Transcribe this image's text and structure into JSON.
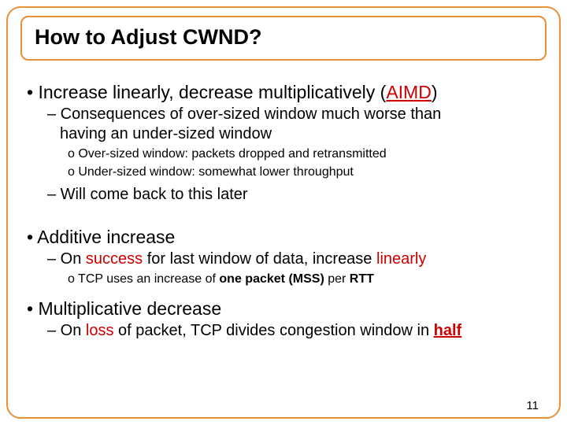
{
  "title": "How to Adjust CWND?",
  "b1": {
    "pre": "• Increase linearly, decrease multiplicatively (",
    "aimd": "AIMD",
    "post": ")"
  },
  "b1s1a": "– Consequences of over-sized window much worse than",
  "b1s1b": "having an under-sized window",
  "b1s1o1": "o Over-sized window: packets dropped and retransmitted",
  "b1s1o2": "o Under-sized window: somewhat lower throughput",
  "b1s2": "– Will come back to this later",
  "b2": "• Additive increase",
  "b2s1": {
    "p1": "– On ",
    "w1": "success",
    "p2": " for last window of data, increase ",
    "w2": "linearly"
  },
  "b2o1": {
    "p1": "o TCP uses an increase of ",
    "w1": "one packet (MSS)",
    "p2": " per ",
    "w2": "RTT"
  },
  "b3": "• Multiplicative decrease",
  "b3s1": {
    "p1": "– On ",
    "w1": "loss",
    "p2": " of packet, TCP divides congestion window in ",
    "w2": "half"
  },
  "page": "11"
}
